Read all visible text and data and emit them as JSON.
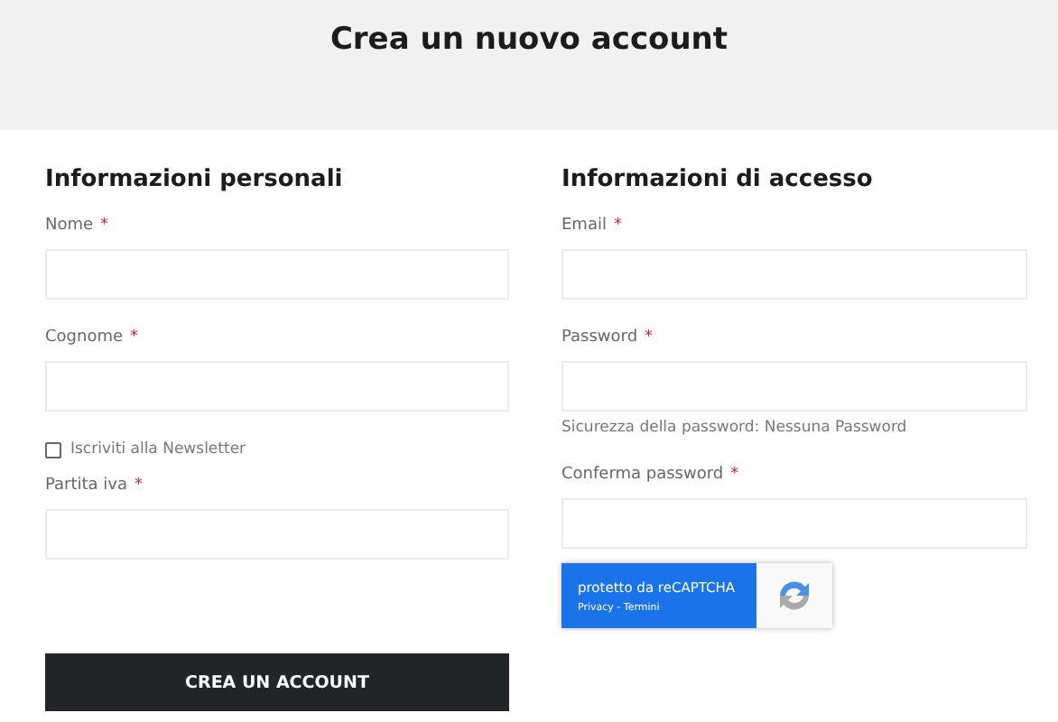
{
  "page_title": "Crea un nuovo account",
  "columns": [
    {
      "heading": "Informazioni personali",
      "items": [
        {
          "kind": "field",
          "label": "Nome",
          "mark": "*"
        },
        {
          "kind": "field",
          "label": "Cognome",
          "mark": "*"
        },
        {
          "kind": "checkbox",
          "label": "Iscriviti alla Newsletter",
          "checked": false
        },
        {
          "kind": "field",
          "label": "Partita iva",
          "mark": "*"
        }
      ]
    },
    {
      "heading": "Informazioni di accesso",
      "items": [
        {
          "kind": "field",
          "label": "Email",
          "mark": "*"
        },
        {
          "kind": "field",
          "label": "Password",
          "mark": "*",
          "note": "Sicurezza della password: Nessuna Password"
        },
        {
          "kind": "field",
          "label": "Conferma password",
          "mark": "*"
        },
        {
          "kind": "recaptcha",
          "label": "protetto da reCAPTCHA",
          "links": "Privacy - Termini"
        }
      ]
    }
  ],
  "submit": "CREA UN ACCOUNT"
}
